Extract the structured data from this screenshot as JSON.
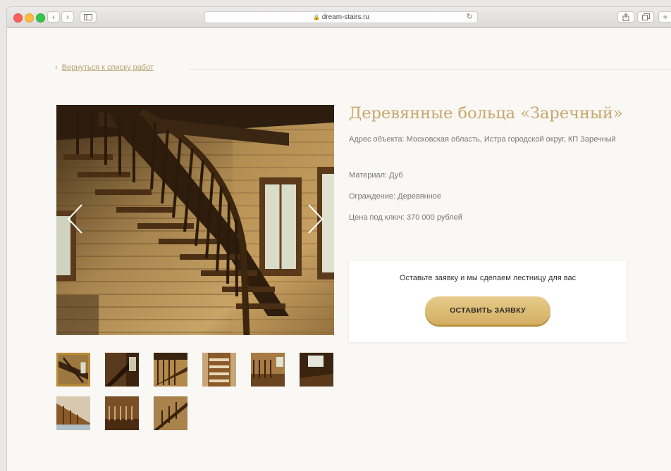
{
  "browser": {
    "url": "dream-stairs.ru",
    "buttons": {
      "back": "‹",
      "forward": "›",
      "reload": "↻",
      "new_tab": "+"
    }
  },
  "page": {
    "back_link": {
      "arrow": "‹",
      "label": "Вернуться к списку работ"
    },
    "title": "Деревянные больца «Заречный»",
    "details": {
      "address": "Адрес объекта: Московская область, Истра городской округ, КП Заречный",
      "material": "Материал: Дуб",
      "railing": "Ограждение: Деревянное",
      "price": "Цена под ключ: 370 000 рублей"
    },
    "cta": {
      "text": "Оставьте заявку и мы сделаем лестницу для вас",
      "button": "ОСТАВИТЬ ЗАЯВКУ"
    },
    "gallery": {
      "thumbnail_count": 9,
      "selected_index": 0
    }
  },
  "colors": {
    "accent_gold": "#c9a66b",
    "button_gold": "#d9b96f",
    "page_bg": "#f9f8f5"
  }
}
